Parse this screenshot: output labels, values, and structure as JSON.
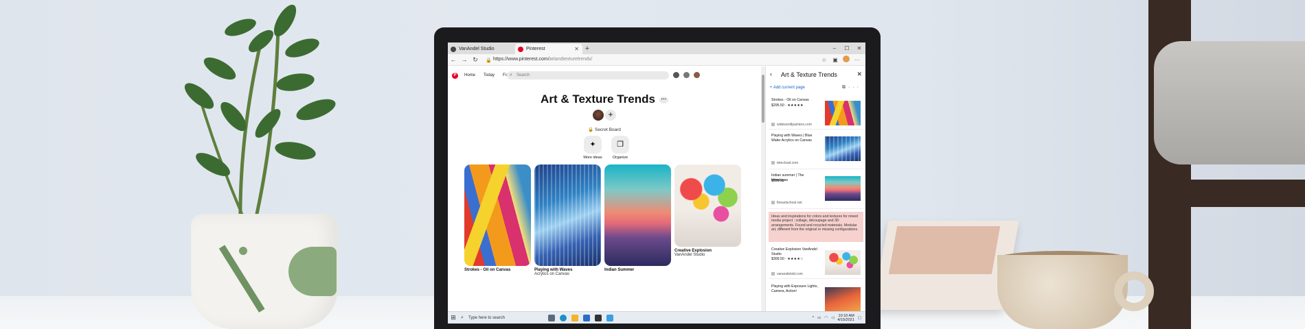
{
  "browser": {
    "tabs": [
      {
        "label": "VanAndel Studio",
        "active": false
      },
      {
        "label": "Pinterest",
        "active": true
      }
    ],
    "new_tab": "+",
    "window_controls": {
      "minimize": "–",
      "maximize": "☐",
      "close": "✕"
    },
    "nav": {
      "back": "←",
      "forward": "→",
      "refresh": "↻"
    },
    "url": {
      "host": "https://www.pinterest.com/",
      "path": "artandtexturetrends/"
    }
  },
  "pinterest": {
    "nav": {
      "home": "Home",
      "today": "Today",
      "following": "Following"
    },
    "search_placeholder": "Search",
    "board": {
      "title": "Art & Texture Trends",
      "more": "···",
      "add": "+",
      "secret_label": "Secret Board",
      "actions": [
        {
          "label": "More ideas",
          "icon": "sparkle-icon",
          "glyph": "✦"
        },
        {
          "label": "Organize",
          "icon": "organize-icon",
          "glyph": "❐"
        }
      ]
    },
    "pins": [
      {
        "title": "Strokes - Oil on Canvas",
        "subtitle": ""
      },
      {
        "title": "Playing with Waves",
        "subtitle": "Acrylics on Canvas"
      },
      {
        "title": "Indian Summer",
        "subtitle": ""
      },
      {
        "title": "Creative Explosion",
        "subtitle": "VanAndel Studio"
      }
    ]
  },
  "collections": {
    "title": "Art & Texture Trends",
    "add_current_page": "+ Add current page",
    "items": [
      {
        "title": "Strokes - Oil on Canvas",
        "price": "$295.50 · ★★★★★",
        "source": "widewordlpainters.com"
      },
      {
        "title": "Playing with Waves | Blue Water Acrylics on Canvas",
        "price": "",
        "source": "tetecloud.com"
      },
      {
        "title": "Indian summer | The Himalayas",
        "price": "$599.50",
        "source": "fineartschool.net"
      },
      {
        "title": "Creative Explosion VanAndel Studio",
        "price": "$309.50 · ★★★★☆",
        "source": "vanandelstd.com"
      },
      {
        "title": "Playing with Exposure Lights, Camera, Action!",
        "price": "",
        "source": ""
      }
    ],
    "note": "Ideas and inspirations for colors and textures for mixed media project : collage, découpage and 3D arrangements. Found and recycled materials. Modular art, different from the original or missing configurations."
  },
  "taskbar": {
    "search_placeholder": "Type here to search",
    "time": "10:10 AM",
    "date": "4/15/2021"
  },
  "colors": {
    "pinterest_red": "#e60023",
    "accent_blue": "#1a62c4",
    "note_pink": "#f6d1ce"
  }
}
